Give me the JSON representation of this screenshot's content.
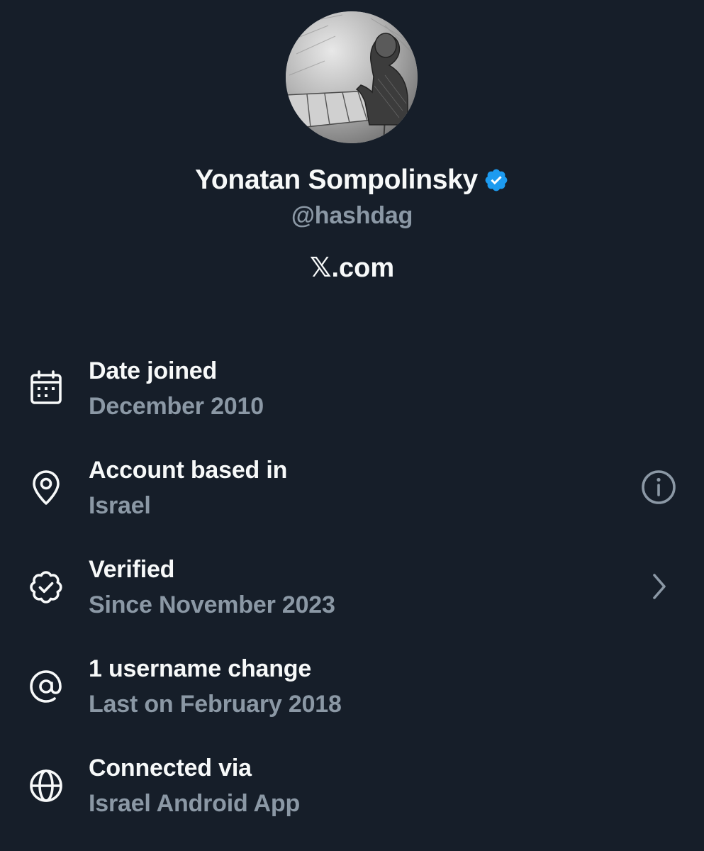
{
  "profile": {
    "display_name": "Yonatan Sompolinsky",
    "handle": "@hashdag",
    "website": "𝕏.com",
    "verified_badge_icon": "verified-badge-icon",
    "avatar_icon": "avatar-sketch-image"
  },
  "colors": {
    "background": "#161e29",
    "primary_text": "#f7f9f9",
    "secondary_text": "#8b98a5",
    "badge_blue": "#1d9bf0"
  },
  "info_rows": [
    {
      "icon": "calendar-icon",
      "title": "Date joined",
      "subtitle": "December 2010"
    },
    {
      "icon": "location-pin-icon",
      "title": "Account based in",
      "subtitle": "Israel",
      "action_icon": "info-circle-icon"
    },
    {
      "icon": "verified-check-icon",
      "title": "Verified",
      "subtitle": "Since November 2023",
      "action_icon": "chevron-right-icon"
    },
    {
      "icon": "at-sign-icon",
      "title": "1 username change",
      "subtitle": "Last on February 2018"
    },
    {
      "icon": "globe-icon",
      "title": "Connected via",
      "subtitle": "Israel Android App"
    }
  ]
}
